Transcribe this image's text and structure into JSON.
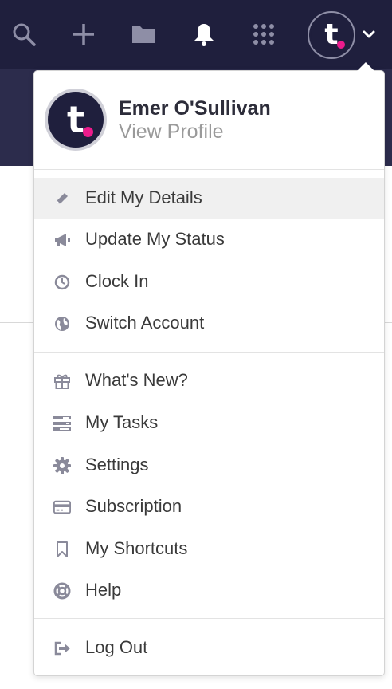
{
  "topbar": {
    "nav_icons": [
      "search-icon",
      "plus-icon",
      "folder-icon",
      "bell-icon",
      "apps-grid-icon"
    ],
    "avatar_letter": "t",
    "chevron": "chevron-down-icon"
  },
  "profile": {
    "avatar_letter": "t",
    "name": "Emer O'Sullivan",
    "link": "View Profile"
  },
  "menu": {
    "section1": [
      {
        "label": "Edit My Details",
        "icon": "pencil-icon",
        "active": true
      },
      {
        "label": "Update My Status",
        "icon": "megaphone-icon"
      },
      {
        "label": "Clock In",
        "icon": "clock-icon"
      },
      {
        "label": "Switch Account",
        "icon": "globe-icon"
      }
    ],
    "section2": [
      {
        "label": "What's New?",
        "icon": "gift-icon"
      },
      {
        "label": "My Tasks",
        "icon": "tasks-icon"
      },
      {
        "label": "Settings",
        "icon": "gear-icon"
      },
      {
        "label": "Subscription",
        "icon": "credit-card-icon"
      },
      {
        "label": "My Shortcuts",
        "icon": "bookmark-icon"
      },
      {
        "label": "Help",
        "icon": "lifebuoy-icon"
      }
    ],
    "section3": [
      {
        "label": "Log Out",
        "icon": "sign-out-icon"
      }
    ]
  },
  "colors": {
    "topbar": "#1f1f3d",
    "accent_dot": "#ec1b8c",
    "active_row": "#f0f0f0",
    "icon_gray": "#8a8a9a"
  }
}
